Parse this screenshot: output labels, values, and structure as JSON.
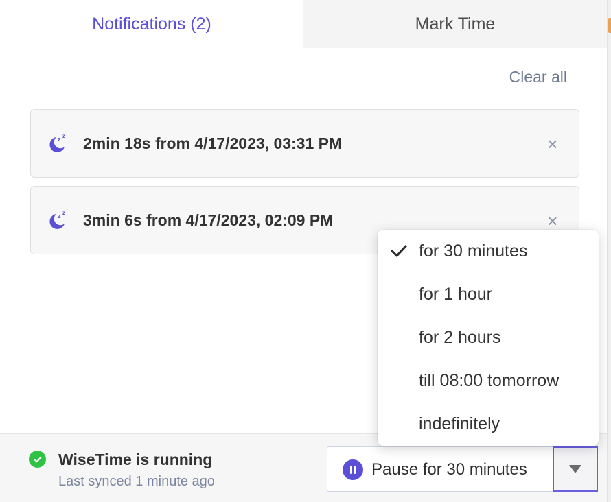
{
  "tabs": [
    {
      "label": "Notifications (2)",
      "active": true
    },
    {
      "label": "Mark Time",
      "active": false
    }
  ],
  "clear_all_label": "Clear all",
  "notifications": [
    {
      "icon": "sleep-moon-icon",
      "text": "2min 18s from 4/17/2023, 03:31 PM"
    },
    {
      "icon": "sleep-moon-icon",
      "text": "3min 6s from 4/17/2023, 02:09 PM"
    }
  ],
  "pause_menu": {
    "selected_index": 0,
    "options": [
      "for 30 minutes",
      "for 1 hour",
      "for 2 hours",
      "till 08:00 tomorrow",
      "indefinitely"
    ]
  },
  "footer": {
    "status_title": "WiseTime is running",
    "status_sub": "Last synced 1 minute ago",
    "pause_label": "Pause for 30 minutes"
  },
  "colors": {
    "accent": "#5b4fd8",
    "running_green": "#2fc245",
    "muted_text": "#7b86a0"
  }
}
